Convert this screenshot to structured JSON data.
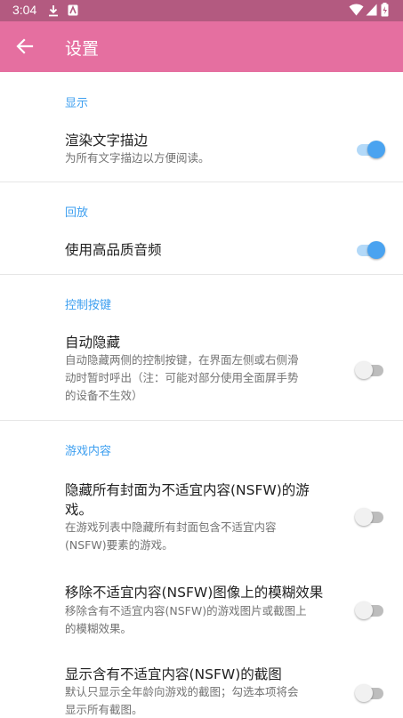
{
  "status_bar": {
    "time": "3:04"
  },
  "app_bar": {
    "title": "设置"
  },
  "sections": {
    "display": {
      "header": "显示",
      "items": [
        {
          "title": "渲染文字描边",
          "subtitle": "为所有文字描边以方便阅读。",
          "checked": true
        }
      ]
    },
    "playback": {
      "header": "回放",
      "items": [
        {
          "title": "使用高品质音频",
          "checked": true
        }
      ]
    },
    "controls": {
      "header": "控制按键",
      "items": [
        {
          "title": "自动隐藏",
          "subtitle_lines": [
            "自动隐藏两侧的控制按键，在界面左侧或右侧滑",
            "动时暂时呼出（注：可能对部分使用全面屏手势",
            "的设备不生效）"
          ],
          "checked": false
        }
      ]
    },
    "game_content": {
      "header": "游戏内容",
      "items": [
        {
          "title_lines": [
            "隐藏所有封面为不适宜内容(NSFW)的游",
            "戏。"
          ],
          "subtitle_lines": [
            "在游戏列表中隐藏所有封面包含不适宜内容",
            "(NSFW)要素的游戏。"
          ],
          "checked": false
        },
        {
          "title": "移除不适宜内容(NSFW)图像上的模糊效果",
          "subtitle_lines": [
            "移除含有不适宜内容(NSFW)的游戏图片或截图上",
            "的模糊效果。"
          ],
          "checked": false
        },
        {
          "title": "显示含有不适宜内容(NSFW)的截图",
          "subtitle_lines": [
            "默认只显示全年龄向游戏的截图；勾选本项将会",
            "显示所有截图。"
          ],
          "checked": false
        }
      ]
    }
  },
  "colors": {
    "status_bar": "#b35a80",
    "app_bar": "#e56fa0",
    "accent": "#3d9ff0"
  },
  "icons": [
    "download-icon",
    "notification-icon",
    "wifi-icon",
    "signal-icon",
    "battery-icon",
    "back-arrow-icon"
  ]
}
